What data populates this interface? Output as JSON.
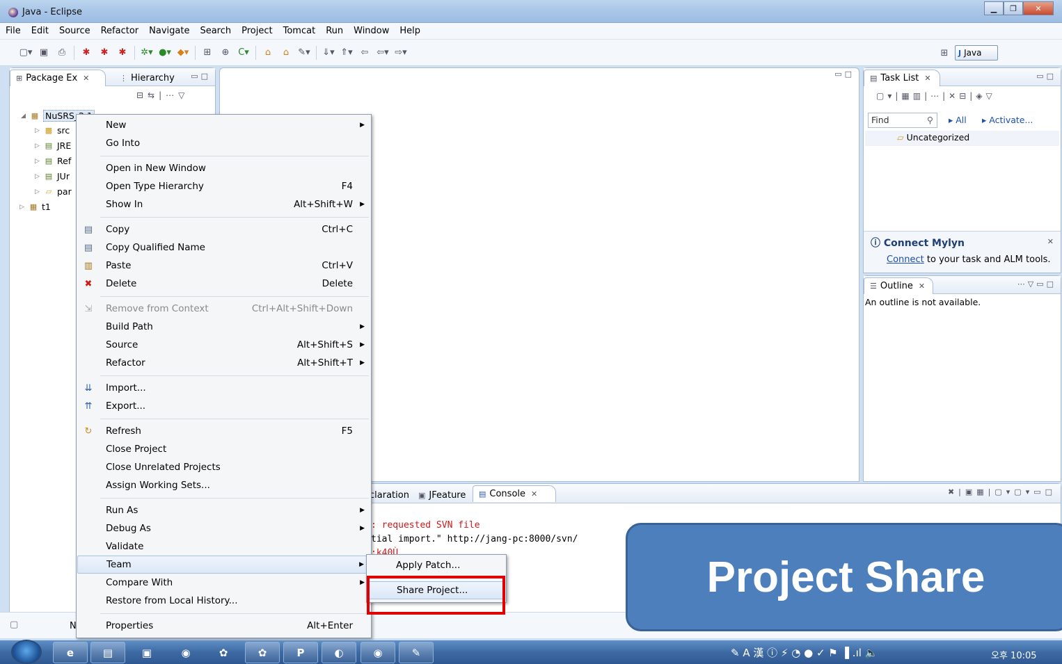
{
  "window": {
    "title": "Java - Eclipse"
  },
  "menubar": [
    "File",
    "Edit",
    "Source",
    "Refactor",
    "Navigate",
    "Search",
    "Project",
    "Tomcat",
    "Run",
    "Window",
    "Help"
  ],
  "perspective": {
    "label": "Java"
  },
  "package_explorer": {
    "tabs": [
      "Package Ex",
      "Hierarchy"
    ],
    "tree": [
      {
        "label": "NuSRS_2.1"
      },
      {
        "label": "src"
      },
      {
        "label": "JRE"
      },
      {
        "label": "Ref"
      },
      {
        "label": "JUr"
      },
      {
        "label": "par"
      },
      {
        "label": "t1"
      }
    ]
  },
  "task_list": {
    "tab": "Task List",
    "find_placeholder": "Find",
    "all": "All",
    "activate": "Activate...",
    "category": "Uncategorized",
    "mylyn_title": "Connect Mylyn",
    "mylyn_link": "Connect",
    "mylyn_text": "to your task and ALM tools."
  },
  "outline": {
    "tab": "Outline",
    "message": "An outline is not available."
  },
  "bottom_panel": {
    "tabs": [
      "claration",
      "JFeature",
      "Console"
    ],
    "lines": [
      ": requested SVN file",
      "tial import.\" http://jang-pc:8000/svn/",
      ":k40Ù"
    ]
  },
  "context_menu": {
    "items": [
      {
        "label": "New",
        "accel": "",
        "sub": true
      },
      {
        "label": "Go Into",
        "accel": "",
        "sub": false
      },
      {
        "label": "Open in New Window",
        "accel": "",
        "sub": false
      },
      {
        "label": "Open Type Hierarchy",
        "accel": "F4",
        "sub": false
      },
      {
        "label": "Show In",
        "accel": "Alt+Shift+W",
        "sub": true
      },
      {
        "label": "Copy",
        "accel": "Ctrl+C",
        "sub": false
      },
      {
        "label": "Copy Qualified Name",
        "accel": "",
        "sub": false
      },
      {
        "label": "Paste",
        "accel": "Ctrl+V",
        "sub": false
      },
      {
        "label": "Delete",
        "accel": "Delete",
        "sub": false
      },
      {
        "label": "Remove from Context",
        "accel": "Ctrl+Alt+Shift+Down",
        "sub": false
      },
      {
        "label": "Build Path",
        "accel": "",
        "sub": true
      },
      {
        "label": "Source",
        "accel": "Alt+Shift+S",
        "sub": true
      },
      {
        "label": "Refactor",
        "accel": "Alt+Shift+T",
        "sub": true
      },
      {
        "label": "Import...",
        "accel": "",
        "sub": false
      },
      {
        "label": "Export...",
        "accel": "",
        "sub": false
      },
      {
        "label": "Refresh",
        "accel": "F5",
        "sub": false
      },
      {
        "label": "Close Project",
        "accel": "",
        "sub": false
      },
      {
        "label": "Close Unrelated Projects",
        "accel": "",
        "sub": false
      },
      {
        "label": "Assign Working Sets...",
        "accel": "",
        "sub": false
      },
      {
        "label": "Run As",
        "accel": "",
        "sub": true
      },
      {
        "label": "Debug As",
        "accel": "",
        "sub": true
      },
      {
        "label": "Validate",
        "accel": "",
        "sub": false
      },
      {
        "label": "Team",
        "accel": "",
        "sub": true
      },
      {
        "label": "Compare With",
        "accel": "",
        "sub": true
      },
      {
        "label": "Restore from Local History...",
        "accel": "",
        "sub": false
      },
      {
        "label": "Properties",
        "accel": "Alt+Enter",
        "sub": false
      }
    ]
  },
  "team_submenu": {
    "items": [
      "Apply Patch...",
      "Share Project..."
    ]
  },
  "callout": {
    "text": "Project Share"
  },
  "statusbar": {
    "text": "N"
  },
  "taskbar": {
    "clock": "오후 10:05",
    "ime": "A 漢"
  },
  "colors": {
    "callout_bg": "#4e7fbd",
    "highlight": "#e00000",
    "task_link": "#1a4fb0"
  }
}
